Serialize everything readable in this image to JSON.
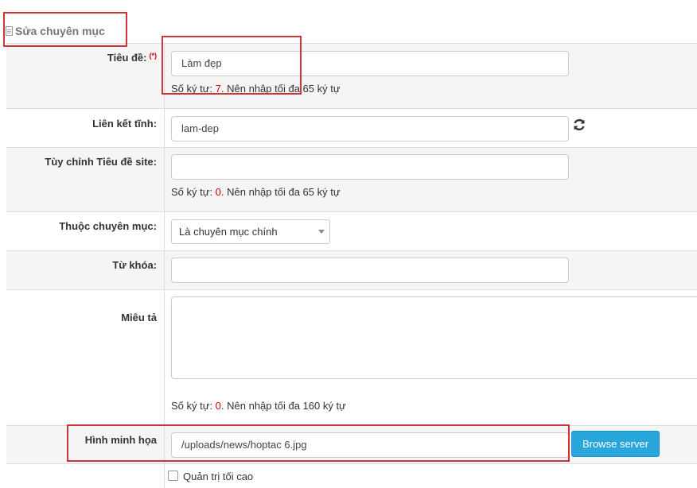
{
  "header": {
    "title": "Sửa chuyên mục",
    "icon": "document-icon"
  },
  "fields": {
    "title": {
      "label": "Tiêu đề:",
      "required_mark": "(*)",
      "value": "Làm đẹp",
      "hint_prefix": "Số ký tự: ",
      "hint_count": "7",
      "hint_suffix": ". Nên nhập tối đa 65 ký tự"
    },
    "alias": {
      "label": "Liên kết tĩnh:",
      "value": "lam-dep",
      "refresh_icon": "refresh-icon"
    },
    "site_title": {
      "label": "Tùy chỉnh Tiêu đề site:",
      "value": "",
      "hint_prefix": "Số ký tự: ",
      "hint_count": "0",
      "hint_suffix": ". Nên nhập tối đa 65 ký tự"
    },
    "parent": {
      "label": "Thuộc chuyên mục:",
      "selected": "Là chuyên mục chính"
    },
    "keywords": {
      "label": "Từ khóa:",
      "value": ""
    },
    "description": {
      "label": "Miêu tả",
      "value": "",
      "hint_prefix": "Số ký tự: ",
      "hint_count": "0",
      "hint_suffix": ". Nên nhập tối đa 160 ký tự"
    },
    "image": {
      "label": "Hình minh họa",
      "value": "/uploads/news/hoptac 6.jpg",
      "button": "Browse server"
    },
    "admin": {
      "label": "Quản trị tối cao"
    }
  },
  "colors": {
    "accent": "#29a6dc",
    "required": "#cc0000",
    "highlight_box": "#d0343b"
  }
}
